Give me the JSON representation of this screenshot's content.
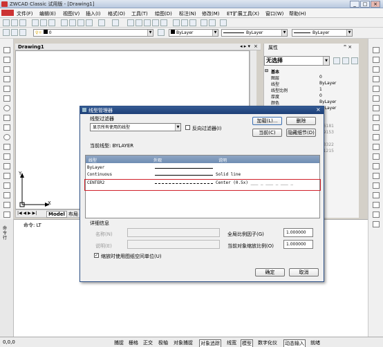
{
  "window": {
    "title": "ZWCAD Classic 试用版 - [Drawing1]",
    "minimize": "_",
    "restore": "□",
    "close": "×"
  },
  "menu": [
    "文件(F)",
    "编辑(E)",
    "视图(V)",
    "插入(I)",
    "格式(O)",
    "工具(T)",
    "绘图(D)",
    "标注(N)",
    "修改(M)",
    "ET扩展工具(X)",
    "窗口(W)",
    "帮助(H)"
  ],
  "toolbar2": {
    "layer_value": "0",
    "color_value": "ByLayer",
    "linetype_value": "ByLayer",
    "lineweight_value": "ByLayer"
  },
  "drawing": {
    "tab_label": "Drawing1",
    "x_axis": "X",
    "y_axis": "Y",
    "model_tab": "Model",
    "layout_tab": "布局"
  },
  "command": {
    "side_label": "命令行",
    "prompt": "命令: LT"
  },
  "properties": {
    "title": "属性",
    "selection": "无选择",
    "section": "基本",
    "rows": [
      {
        "k": "图层",
        "v": "0"
      },
      {
        "k": "线型",
        "v": "ByLayer"
      },
      {
        "k": "线型比例",
        "v": "1"
      },
      {
        "k": "厚度",
        "v": "0"
      },
      {
        "k": "颜色",
        "v": "ByLayer"
      },
      {
        "k": "线宽",
        "v": "ByLayer"
      }
    ],
    "partial_values": [
      "5.6181",
      "9.9153",
      "",
      "5.3322",
      "4.1215",
      ""
    ]
  },
  "status": {
    "coords": "0,0,0",
    "buttons": [
      "捕捉",
      "栅格",
      "正交",
      "极轴",
      "对象捕捉",
      "对象追踪",
      "线宽",
      "模型",
      "数字化仪",
      "动态输入",
      "就绪"
    ]
  },
  "dialog": {
    "title": "线型管理器",
    "filter_label": "线型过滤器",
    "filter_value": "显示所有使用的线型",
    "invert_label": "反向过滤器(I)",
    "load_btn": "加载(L)...",
    "delete_btn": "删除",
    "current_btn": "当前(C)",
    "hide_detail_btn": "隐藏细节(D)",
    "current_linetype": "当前线型: BYLAYER",
    "columns": [
      "线型",
      "外观",
      "说明"
    ],
    "rows": [
      {
        "name": "ByLayer",
        "desc": ""
      },
      {
        "name": "Continuous",
        "desc": "Solid line"
      },
      {
        "name": "CENTER2",
        "desc": "Center (0.5x) ___ _ ___ _ ___ _"
      }
    ],
    "detail_label": "详细信息",
    "name_label": "名称(N)",
    "desc_label": "说明(E)",
    "global_scale_label": "全局比例因子(G)",
    "global_scale_value": "1.000000",
    "current_scale_label": "当前对象缩放比例(O)",
    "current_scale_value": "1.000000",
    "paperspace_label": "缩放时使用图纸空间单位(U)",
    "ok_btn": "确定",
    "cancel_btn": "取消",
    "close_glyph": "×"
  },
  "colors": {
    "highlight_box": "#d0202a",
    "dialog_title": "#1d3f76"
  }
}
